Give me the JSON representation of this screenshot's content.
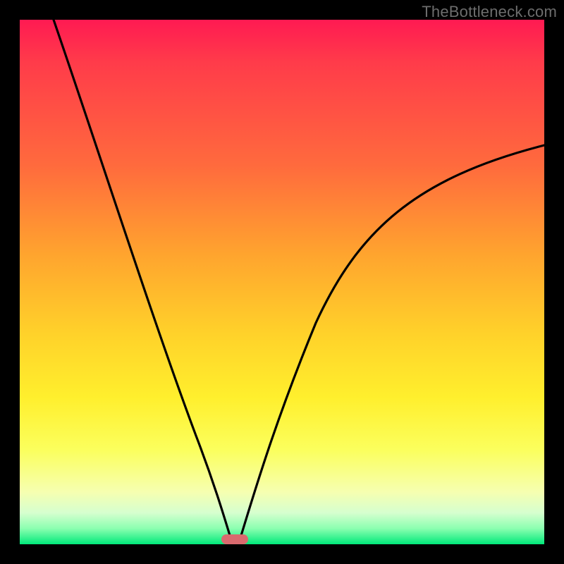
{
  "watermark": "TheBottleneck.com",
  "colors": {
    "frame": "#000000",
    "gradient_top": "#ff1a52",
    "gradient_mid": "#ffd22a",
    "gradient_bottom": "#00e97a",
    "curve": "#000000",
    "marker": "#d96a6e"
  },
  "chart_data": {
    "type": "line",
    "title": "",
    "xlabel": "",
    "ylabel": "",
    "xlim": [
      0,
      100
    ],
    "ylim": [
      0,
      100
    ],
    "x": [
      0,
      5,
      10,
      15,
      20,
      25,
      30,
      33,
      36,
      38,
      40,
      42,
      45,
      50,
      55,
      60,
      65,
      70,
      75,
      80,
      85,
      90,
      95,
      100
    ],
    "values": [
      100,
      87,
      74,
      62,
      50,
      38,
      25,
      15,
      7,
      2,
      0,
      2,
      8,
      20,
      32,
      42,
      50,
      57,
      62,
      66,
      69,
      71,
      72,
      73
    ],
    "minimum_x": 40,
    "marker": {
      "x_center": 40,
      "width_pct": 5
    },
    "grid": false,
    "legend": false
  }
}
